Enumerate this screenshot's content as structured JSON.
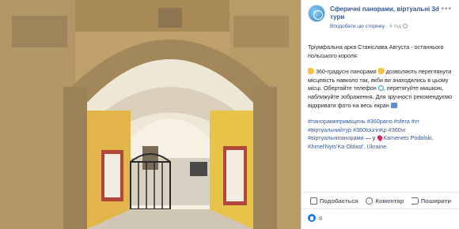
{
  "post": {
    "page_name": "Сферичні панорами, віртуальні 3d тури",
    "like_page": "Вподобати цю сторінку",
    "separator": " · ",
    "time": "4 год",
    "title": "Тріумфальна арка Станіслава Августа - останнього польського короля",
    "body_1": " 360-градусні панорами ",
    "body_2": " дозволяють переглянути місцевість навколо так, якби ви знаходились в цьому місці. Обертайте телефон ",
    "body_3": ", перетягуйте мишкою, наближуйте зображення. Для зручності рекомендуємо відкривати фото на весь екран ",
    "hashtags": "#панорамиприміщень #360pano #sfera #vr #віртуальнийтур #360tourinKp #360vr #віртуальніпанорами",
    "location_prefix": " — у ",
    "location": "Kamenets Podolski, Khmel'Nyts'Ka Oblast', Ukraine",
    "location_suffix": "."
  },
  "actions": {
    "like": "Подобається",
    "comment": "Коментар",
    "share": "Поширити"
  },
  "reactions": {
    "count": "8"
  },
  "icons": {
    "more": "more-horizontal-icon",
    "avatar": "page-avatar-360-icon",
    "globe": "globe-icon"
  },
  "colors": {
    "link": "#365899",
    "like_blue": "#1877f2",
    "wall_yellow": "#e8c34a"
  }
}
